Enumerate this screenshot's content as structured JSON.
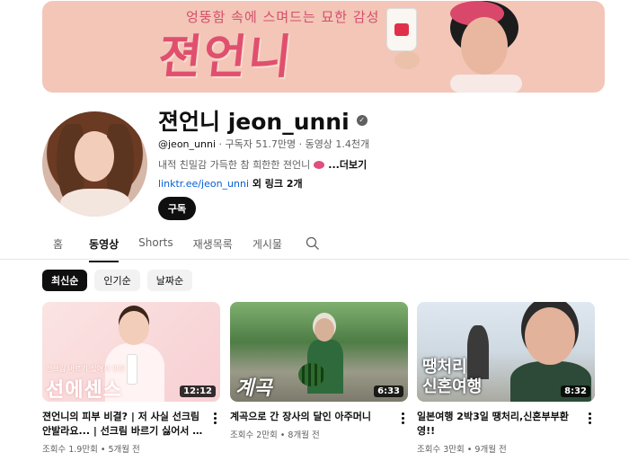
{
  "banner": {
    "tagline": "엉뚱함 속에 스며드는 묘한 감성",
    "logo_text": "젼언니"
  },
  "channel": {
    "name": "젼언니 jeon_unni",
    "handle": "@jeon_unni",
    "stats": " · 구독자 51.7만명 · 동영상 1.4천개",
    "description": "내적 친밀감 가득한 참 희한한 젼언니",
    "more_label": "...더보기",
    "link": "linktr.ee/jeon_unni",
    "extra_links": " 외 링크 2개",
    "subscribe_label": "구독"
  },
  "tabs": [
    {
      "label": "홈",
      "active": false
    },
    {
      "label": "동영상",
      "active": true
    },
    {
      "label": "Shorts",
      "active": false
    },
    {
      "label": "재생목록",
      "active": false
    },
    {
      "label": "게시물",
      "active": false
    }
  ],
  "chips": [
    {
      "label": "최신순",
      "active": true
    },
    {
      "label": "인기순",
      "active": false
    },
    {
      "label": "날짜순",
      "active": false
    }
  ],
  "videos": [
    {
      "title": "젼언니의 피부 비결? | 저 사실 선크림 안발라요... | 선크림 바르기 싫어서 만든 선에...",
      "views": "조회수 1.9만회",
      "age": "5개월 전",
      "duration": "12:12",
      "thumb_text_small": "선크림 바르기 싫어서 만든",
      "thumb_text": "선에센스"
    },
    {
      "title": "계곡으로 간 장사의 달인 아주머니",
      "views": "조회수 2만회",
      "age": "8개월 전",
      "duration": "6:33",
      "thumb_text": "계곡"
    },
    {
      "title": "일본여행 2박3일 땡처리,신혼부부환영!!",
      "views": "조회수 3만회",
      "age": "9개월 전",
      "duration": "8:32",
      "thumb_text_line1": "땡처리",
      "thumb_text_line2": "신혼여행"
    }
  ]
}
